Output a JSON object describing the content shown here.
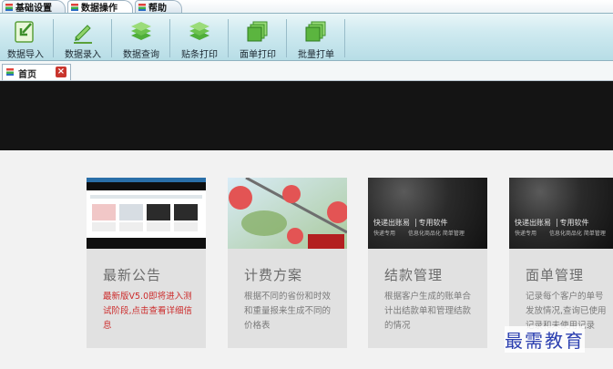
{
  "menu": {
    "tabs": [
      {
        "label": "基础设置"
      },
      {
        "label": "数据操作"
      },
      {
        "label": "帮助"
      }
    ]
  },
  "toolbar": {
    "buttons": [
      {
        "label": "数据导入",
        "icon": "import-icon"
      },
      {
        "label": "数据录入",
        "icon": "pencil-icon"
      },
      {
        "label": "数据查询",
        "icon": "stack-icon"
      },
      {
        "label": "贴条打印",
        "icon": "stack-icon"
      },
      {
        "label": "面单打印",
        "icon": "pages-icon"
      },
      {
        "label": "批量打单",
        "icon": "pages-icon"
      }
    ]
  },
  "doc_tabs": [
    {
      "label": "首页",
      "close": "×"
    }
  ],
  "cards": [
    {
      "title": "最新公告",
      "desc": "最新版V5.0即将进入测试阶段,点击查看详细信息",
      "highlight": true
    },
    {
      "title": "计费方案",
      "desc": "根据不同的省份和时效和重量报来生成不同的价格表",
      "highlight": false
    },
    {
      "title": "结款管理",
      "desc": "根据客户生成的账单合计出结款单和管理结款的情况",
      "highlight": false
    },
    {
      "title": "面单管理",
      "desc": "记录每个客户的单号发放情况,查询已使用记录和未使用记录",
      "highlight": false
    }
  ],
  "thumb_text": {
    "courier_main": "快递出账易",
    "courier_sub": "专用软件",
    "courier_line2": "信息化商品化 简单管理",
    "courier_small": "快递专用"
  },
  "watermark": "最需教育",
  "colors": {
    "toolbar_top": "#e9f6f8",
    "toolbar_bottom": "#b7dde6",
    "highlight_text": "#cc2c2c",
    "close_button": "#c9352d"
  }
}
